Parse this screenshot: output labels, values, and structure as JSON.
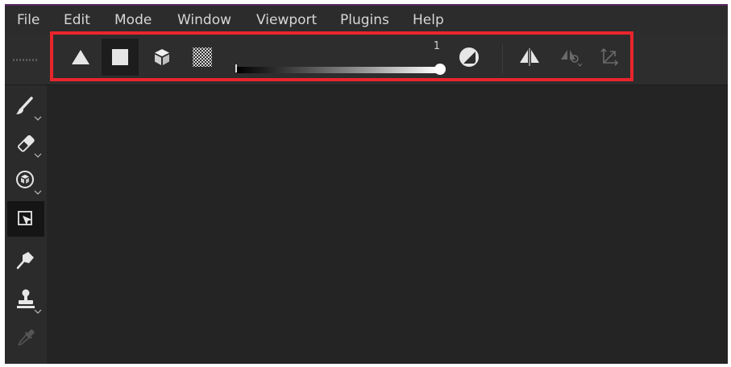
{
  "menu": [
    "File",
    "Edit",
    "Mode",
    "Window",
    "Viewport",
    "Plugins",
    "Help"
  ],
  "toolbar": {
    "tools": [
      "triangle-icon",
      "square-icon",
      "cube-icon",
      "checkerboard-icon"
    ],
    "active_tool": "square-icon",
    "slider_value": "1",
    "slider_fraction": 1,
    "right_icons": [
      "contrast-icon",
      "symmetry-icon",
      "symmetry-options-icon",
      "transform-axis-icon"
    ]
  },
  "sidebar": {
    "tools": [
      "brush-icon",
      "eraser-icon",
      "projection-icon",
      "polygon-fill-icon",
      "smudge-icon",
      "clone-stamp-icon",
      "color-picker-icon"
    ],
    "active_tool": "polygon-fill-icon"
  },
  "colors": {
    "highlight": "#e8252b",
    "accent": "#5a2a63",
    "background": "#262626"
  }
}
